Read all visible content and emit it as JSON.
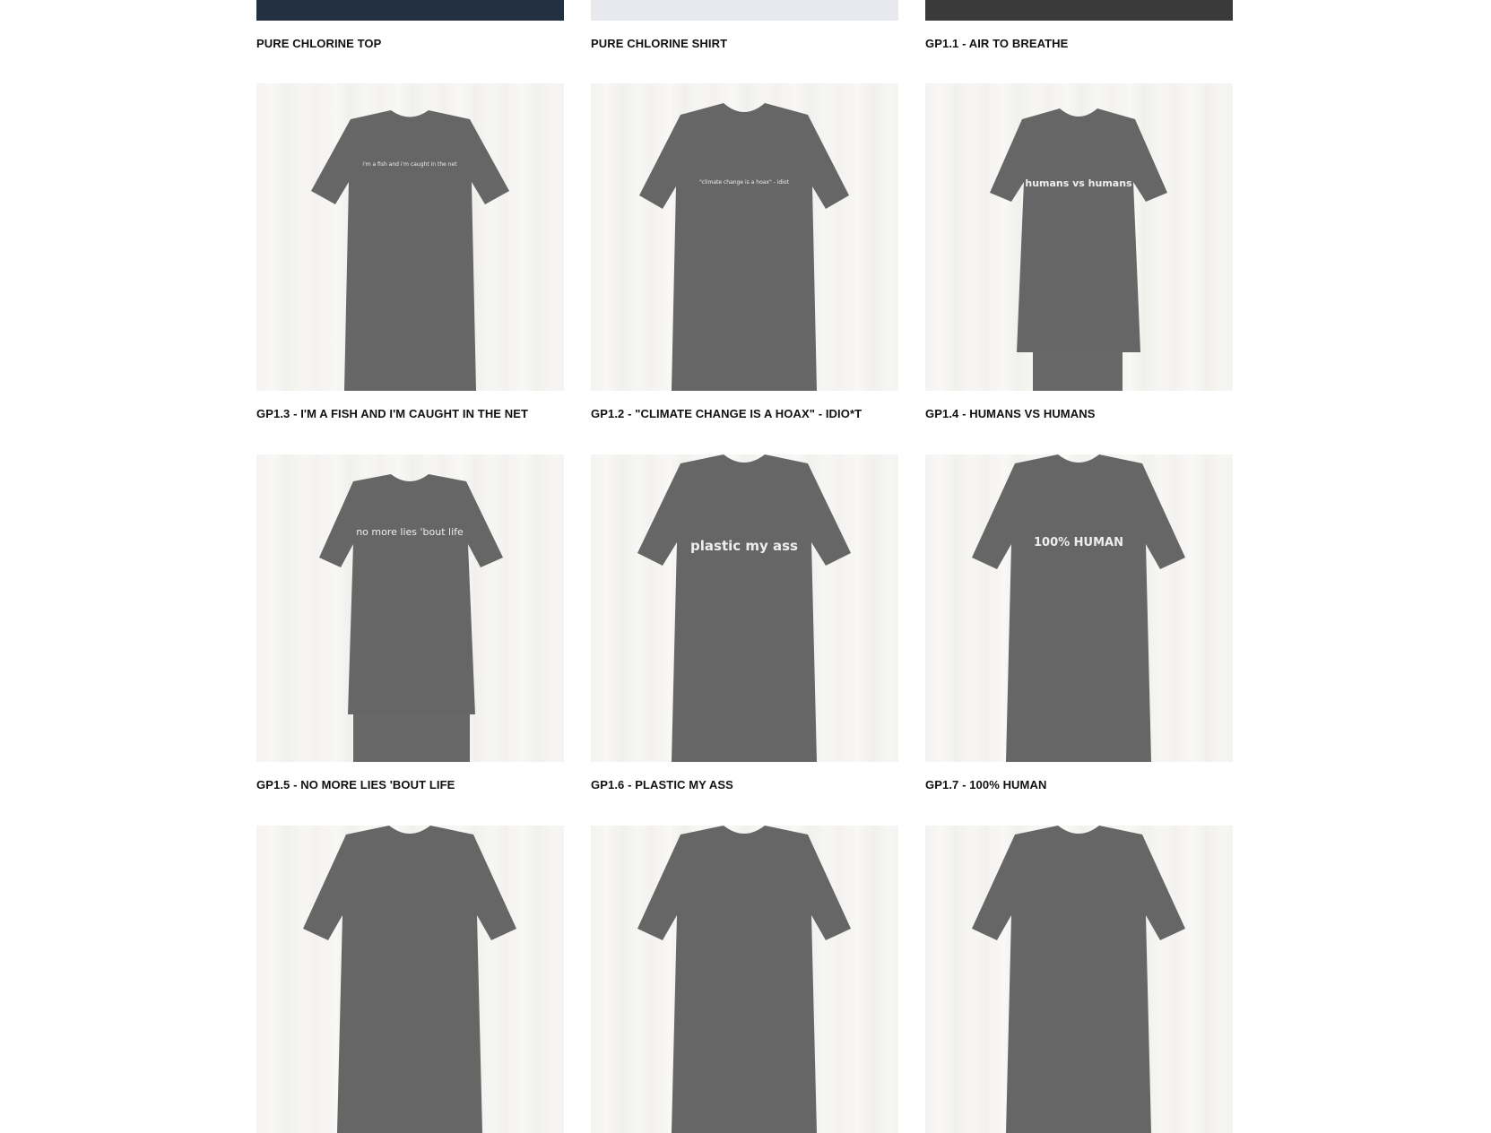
{
  "products": [
    {
      "title": "PURE CHLORINE TOP",
      "image": "dark-denim-top-photo",
      "shirt_text": ""
    },
    {
      "title": "PURE CHLORINE SHIRT",
      "image": "light-shirt-photo",
      "shirt_text": ""
    },
    {
      "title": "GP1.1 - AIR TO BREATHE",
      "image": "black-tee-photo",
      "shirt_text": ""
    },
    {
      "title": "GP1.3 - I'M A FISH AND I'M CAUGHT IN THE NET",
      "image": "black-tee-photo",
      "shirt_text": "i'm a fish and i'm caught in the net"
    },
    {
      "title": "GP1.2 - \"CLIMATE CHANGE IS A HOAX\" - IDIO*T",
      "image": "black-tee-photo",
      "shirt_text": "\"climate change is a hoax\" - idiot"
    },
    {
      "title": "GP1.4 - HUMANS VS HUMANS",
      "image": "black-tee-photo",
      "shirt_text": "humans vs humans"
    },
    {
      "title": "GP1.5 - NO MORE LIES 'BOUT LIFE",
      "image": "black-tee-photo",
      "shirt_text": "no more lies 'bout life"
    },
    {
      "title": "GP1.6 - PLASTIC MY ASS",
      "image": "black-tee-photo",
      "shirt_text": "plastic my ass"
    },
    {
      "title": "GP1.7 - 100% HUMAN",
      "image": "black-tee-photo",
      "shirt_text": "100% HUMAN"
    }
  ],
  "colors": {
    "tee": "#2b2b2b",
    "background": "#f2f1ee",
    "label": "#111111"
  }
}
